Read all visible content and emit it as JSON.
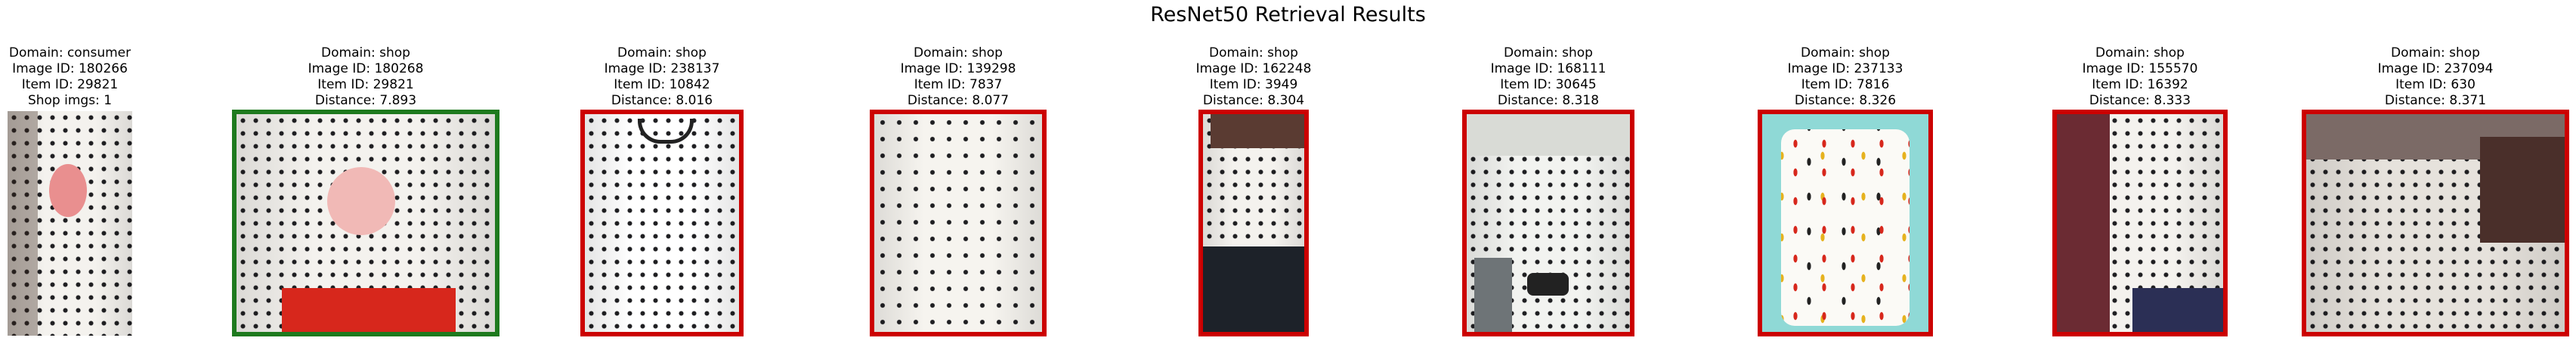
{
  "title": "ResNet50 Retrieval Results",
  "border_colors": {
    "match": "#1e7a1e",
    "mismatch": "#cc0000"
  },
  "query": {
    "domain": "Domain: consumer",
    "image_id": "Image ID: 180266",
    "item_id": "Item ID: 29821",
    "shop_imgs": "Shop imgs: 1"
  },
  "results": [
    {
      "domain": "Domain: shop",
      "image_id": "Image ID: 180268",
      "item_id": "Item ID: 29821",
      "distance": "Distance: 7.893",
      "match": true
    },
    {
      "domain": "Domain: shop",
      "image_id": "Image ID: 238137",
      "item_id": "Item ID: 10842",
      "distance": "Distance: 8.016",
      "match": false
    },
    {
      "domain": "Domain: shop",
      "image_id": "Image ID: 139298",
      "item_id": "Item ID: 7837",
      "distance": "Distance: 8.077",
      "match": false
    },
    {
      "domain": "Domain: shop",
      "image_id": "Image ID: 162248",
      "item_id": "Item ID: 3949",
      "distance": "Distance: 8.304",
      "match": false
    },
    {
      "domain": "Domain: shop",
      "image_id": "Image ID: 168111",
      "item_id": "Item ID: 30645",
      "distance": "Distance: 8.318",
      "match": false
    },
    {
      "domain": "Domain: shop",
      "image_id": "Image ID: 237133",
      "item_id": "Item ID: 7816",
      "distance": "Distance: 8.326",
      "match": false
    },
    {
      "domain": "Domain: shop",
      "image_id": "Image ID: 155570",
      "item_id": "Item ID: 16392",
      "distance": "Distance: 8.333",
      "match": false
    },
    {
      "domain": "Domain: shop",
      "image_id": "Image ID: 237094",
      "item_id": "Item ID: 630",
      "distance": "Distance: 8.371",
      "match": false
    }
  ]
}
